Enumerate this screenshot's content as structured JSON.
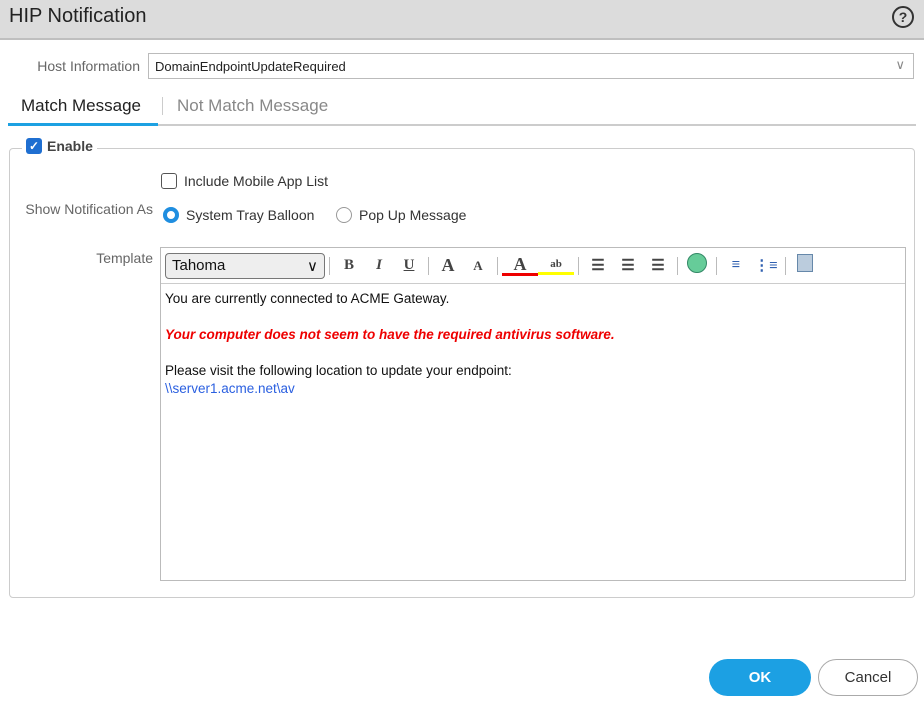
{
  "title": "HIP Notification",
  "help_icon": "?",
  "host_info": {
    "label": "Host Information",
    "value": "DomainEndpointUpdateRequired"
  },
  "tabs": [
    {
      "label": "Match Message",
      "active": true
    },
    {
      "label": "Not Match Message",
      "active": false
    }
  ],
  "enable": {
    "label": "Enable",
    "checked": true
  },
  "include_mobile": {
    "label": "Include Mobile App List",
    "checked": false
  },
  "show_as": {
    "label": "Show Notification As",
    "options": [
      {
        "label": "System Tray Balloon",
        "selected": true
      },
      {
        "label": "Pop Up Message",
        "selected": false
      }
    ]
  },
  "template": {
    "label": "Template",
    "font": "Tahoma",
    "toolbar": {
      "bold": "B",
      "italic": "I",
      "underline": "U",
      "grow": "A",
      "shrink": "A",
      "color": "A",
      "highlight": "ab"
    },
    "lines": [
      "You are currently connected to ACME Gateway.",
      "Your computer does not seem to have the required antivirus software.",
      "Please visit the following location to update your endpoint:",
      "\\\\server1.acme.net\\av"
    ]
  },
  "buttons": {
    "ok": "OK",
    "cancel": "Cancel"
  }
}
